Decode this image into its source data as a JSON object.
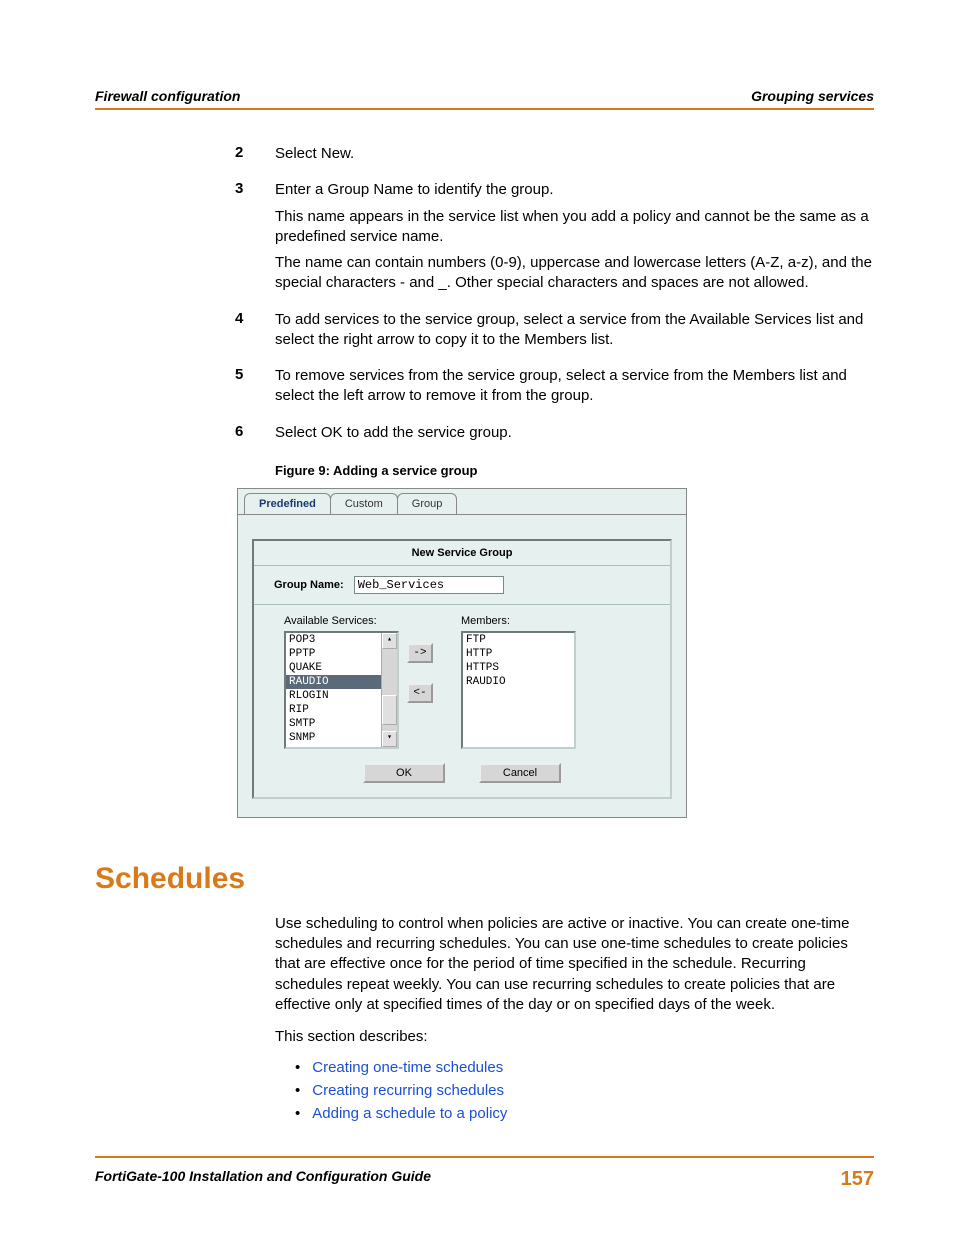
{
  "header": {
    "left": "Firewall configuration",
    "right": "Grouping services"
  },
  "steps": [
    {
      "num": "2",
      "paras": [
        "Select New."
      ]
    },
    {
      "num": "3",
      "paras": [
        "Enter a Group Name to identify the group.",
        "This name appears in the service list when you add a policy and cannot be the same as a predefined service name.",
        "The name can contain numbers (0-9), uppercase and lowercase letters (A-Z, a-z), and the special characters - and _. Other special characters and spaces are not allowed."
      ]
    },
    {
      "num": "4",
      "paras": [
        "To add services to the service group, select a service from the Available Services list and select the right arrow to copy it to the Members list."
      ]
    },
    {
      "num": "5",
      "paras": [
        "To remove services from the service group, select a service from the Members list and select the left arrow to remove it from the group."
      ]
    },
    {
      "num": "6",
      "paras": [
        "Select OK to add the service group."
      ]
    }
  ],
  "figure": {
    "caption": "Figure 9:   Adding a service group",
    "tabs": [
      "Predefined",
      "Custom",
      "Group"
    ],
    "panel_title": "New Service Group",
    "group_name_label": "Group Name:",
    "group_name_value": "Web_Services",
    "available_label": "Available Services:",
    "members_label": "Members:",
    "available": [
      "POP3",
      "PPTP",
      "QUAKE",
      "RAUDIO",
      "RLOGIN",
      "RIP",
      "SMTP",
      "SNMP"
    ],
    "available_selected": "RAUDIO",
    "members": [
      "FTP",
      "HTTP",
      "HTTPS",
      "RAUDIO"
    ],
    "arrow_right": "->",
    "arrow_left": "<-",
    "ok": "OK",
    "cancel": "Cancel"
  },
  "section_heading": "Schedules",
  "section_para1": "Use scheduling to control when policies are active or inactive. You can create one-time schedules and recurring schedules. You can use one-time schedules to create policies that are effective once for the period of time specified in the schedule. Recurring schedules repeat weekly. You can use recurring schedules to create policies that are effective only at specified times of the day or on specified days of the week.",
  "section_para2": "This section describes:",
  "links": [
    "Creating one-time schedules",
    "Creating recurring schedules",
    "Adding a schedule to a policy"
  ],
  "footer": {
    "text": "FortiGate-100 Installation and Configuration Guide",
    "page": "157"
  }
}
